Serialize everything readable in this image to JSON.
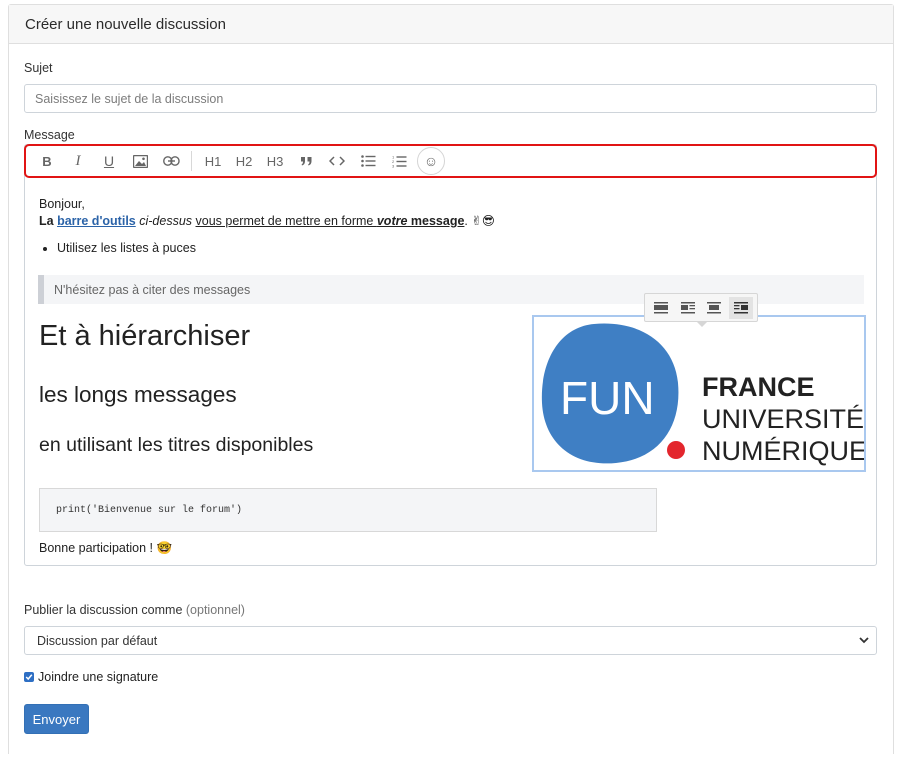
{
  "card": {
    "title": "Créer une nouvelle discussion"
  },
  "subject": {
    "label": "Sujet",
    "placeholder": "Saisissez le sujet de la discussion"
  },
  "message": {
    "label": "Message"
  },
  "toolbar": {
    "bold": "B",
    "italic": "I",
    "underline": "U",
    "h1": "H1",
    "h2": "H2",
    "h3": "H3",
    "emoji": "☺"
  },
  "editor": {
    "greeting": "Bonjour,",
    "line2_a": "La ",
    "line2_link": "barre d'outils",
    "line2_b": " ",
    "line2_italic": "ci-dessus",
    "line2_c": " ",
    "line2_underline": "vous permet de mettre en forme ",
    "line2_bolditalic": "votre",
    "line2_bold": " message",
    "line2_d": ". ✌😎",
    "bullet": "Utilisez les listes à puces",
    "quote": "N'hésitez pas à citer des messages",
    "heading1": "Et à hiérarchiser",
    "heading2": "les longs messages",
    "heading3": "en utilisant les titres disponibles",
    "code": "print('Bienvenue sur le forum')",
    "closing": "Bonne participation ! 🤓"
  },
  "logo": {
    "left": "FUN",
    "right_1": "FRANCE",
    "right_2": "UNIVERSITÉ",
    "right_3": "NUMÉRIQUE",
    "blue": "#3f7fc4",
    "red": "#e3262d"
  },
  "publish": {
    "label": "Publier la discussion comme",
    "label_optional": "(optionnel)",
    "selected": "Discussion par défaut"
  },
  "signature": {
    "label": "Joindre une signature",
    "checked": true
  },
  "submit": {
    "label": "Envoyer"
  }
}
